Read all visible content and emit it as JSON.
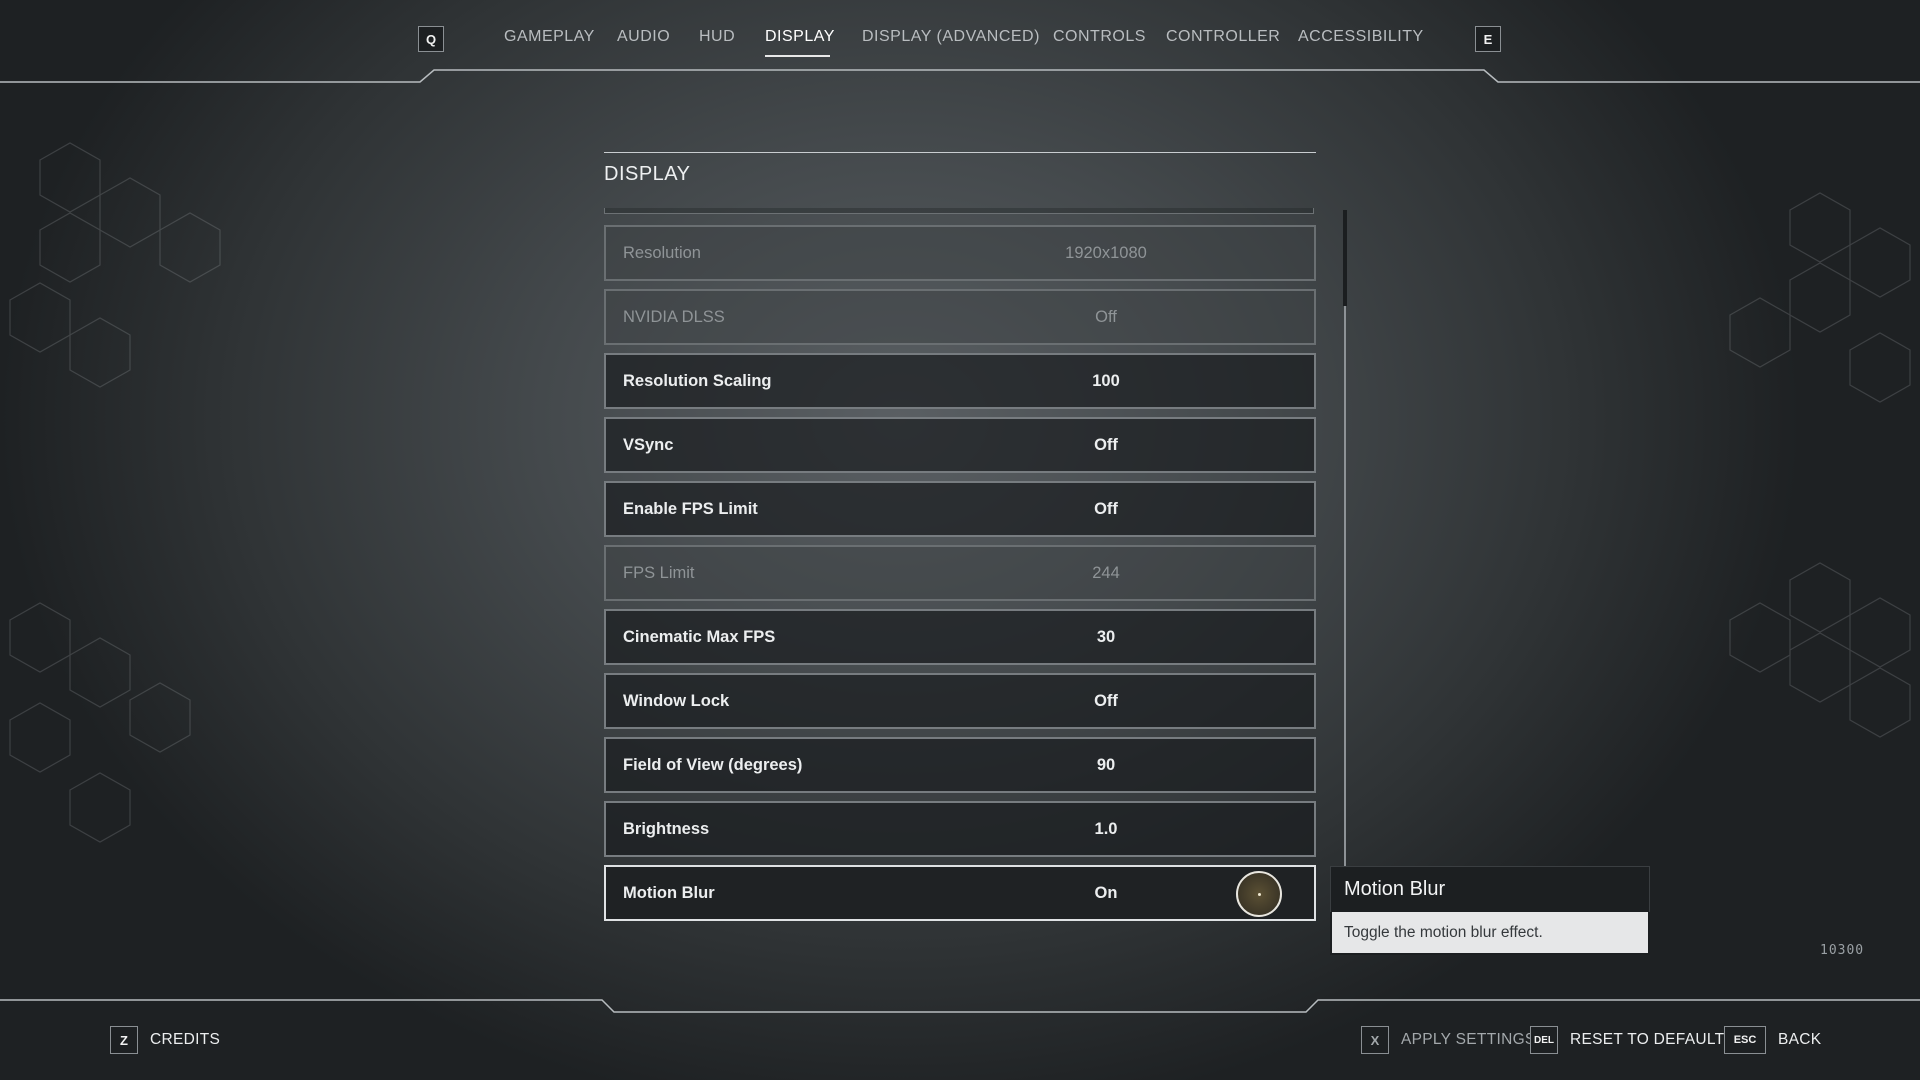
{
  "nav": {
    "prev_key": "Q",
    "next_key": "E",
    "tabs": [
      {
        "label": "GAMEPLAY"
      },
      {
        "label": "AUDIO"
      },
      {
        "label": "HUD"
      },
      {
        "label": "DISPLAY",
        "active": true
      },
      {
        "label": "DISPLAY (ADVANCED)"
      },
      {
        "label": "CONTROLS"
      },
      {
        "label": "CONTROLLER"
      },
      {
        "label": "ACCESSIBILITY"
      }
    ]
  },
  "panel": {
    "title": "DISPLAY",
    "settings": [
      {
        "label": "Resolution",
        "value": "1920x1080",
        "state": "disabled"
      },
      {
        "label": "NVIDIA DLSS",
        "value": "Off",
        "state": "disabled"
      },
      {
        "label": "Resolution Scaling",
        "value": "100",
        "state": "enabled"
      },
      {
        "label": "VSync",
        "value": "Off",
        "state": "enabled"
      },
      {
        "label": "Enable FPS Limit",
        "value": "Off",
        "state": "enabled"
      },
      {
        "label": "FPS Limit",
        "value": "244",
        "state": "disabled"
      },
      {
        "label": "Cinematic Max FPS",
        "value": "30",
        "state": "enabled"
      },
      {
        "label": "Window Lock",
        "value": "Off",
        "state": "enabled"
      },
      {
        "label": "Field of View (degrees)",
        "value": "90",
        "state": "enabled"
      },
      {
        "label": "Brightness",
        "value": "1.0",
        "state": "enabled"
      },
      {
        "label": "Motion Blur",
        "value": "On",
        "state": "selected"
      }
    ]
  },
  "tooltip": {
    "title": "Motion Blur",
    "description": "Toggle the motion blur effect."
  },
  "build_number": "10300",
  "footer": {
    "credits": {
      "key": "Z",
      "label": "CREDITS"
    },
    "apply": {
      "key": "X",
      "label": "APPLY SETTINGS"
    },
    "reset": {
      "key": "DEL",
      "label": "RESET TO DEFAULTS"
    },
    "back": {
      "key": "ESC",
      "label": "BACK"
    }
  },
  "colors": {
    "background": "#44494c",
    "row_border": "#777c80",
    "selected_border": "#dfe2e4",
    "tooltip_body": "#e6e7e8"
  }
}
